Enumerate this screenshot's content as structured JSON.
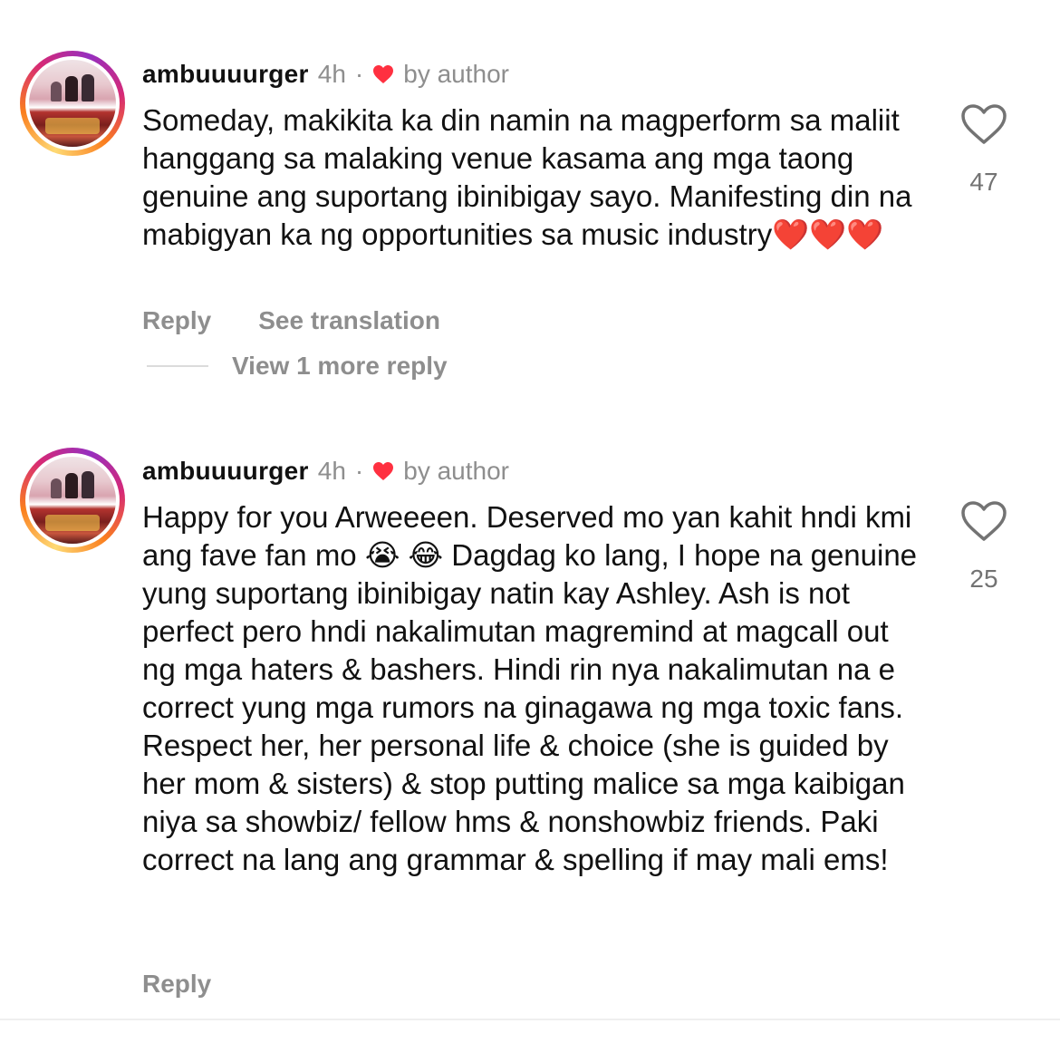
{
  "comments": [
    {
      "username": "ambuuuurger",
      "time": "4h",
      "separator": "·",
      "liked_by": "by author",
      "text": "Someday, makikita ka din namin na magperform sa maliit hanggang sa malaking venue kasama ang mga taong genuine ang suportang ibinibigay sayo. Manifesting din na mabigyan ka ng opportunities sa music industry❤️❤️❤️",
      "like_count": "47",
      "reply_label": "Reply",
      "translation_label": "See translation",
      "view_replies_label": "View 1 more reply"
    },
    {
      "username": "ambuuuurger",
      "time": "4h",
      "separator": "·",
      "liked_by": "by author",
      "text": "Happy for you Arweeeen. Deserved mo yan kahit hndi kmi ang fave fan mo 😭 😂 Dagdag ko lang, I hope na genuine yung suportang ibinibigay natin kay Ashley. Ash is not perfect pero hndi nakalimutan magremind at magcall out ng mga haters & bashers. Hindi rin nya nakalimutan na e correct yung mga rumors na ginagawa ng mga toxic fans. Respect her, her personal life & choice (she is guided by her mom & sisters) & stop putting malice sa mga kaibigan niya sa showbiz/ fellow hms & nonshowbiz friends. Paki correct na lang ang grammar & spelling if may mali ems!",
      "like_count": "25",
      "reply_label": "Reply"
    }
  ],
  "colors": {
    "author_heart": "#ff3040",
    "muted_text": "#8e8e8e",
    "ring_gradient": [
      "#feda75",
      "#fa7e1e",
      "#d62976",
      "#962fbf"
    ]
  },
  "icons": {
    "like": "heart-outline-icon",
    "author_like": "heart-filled-icon"
  }
}
